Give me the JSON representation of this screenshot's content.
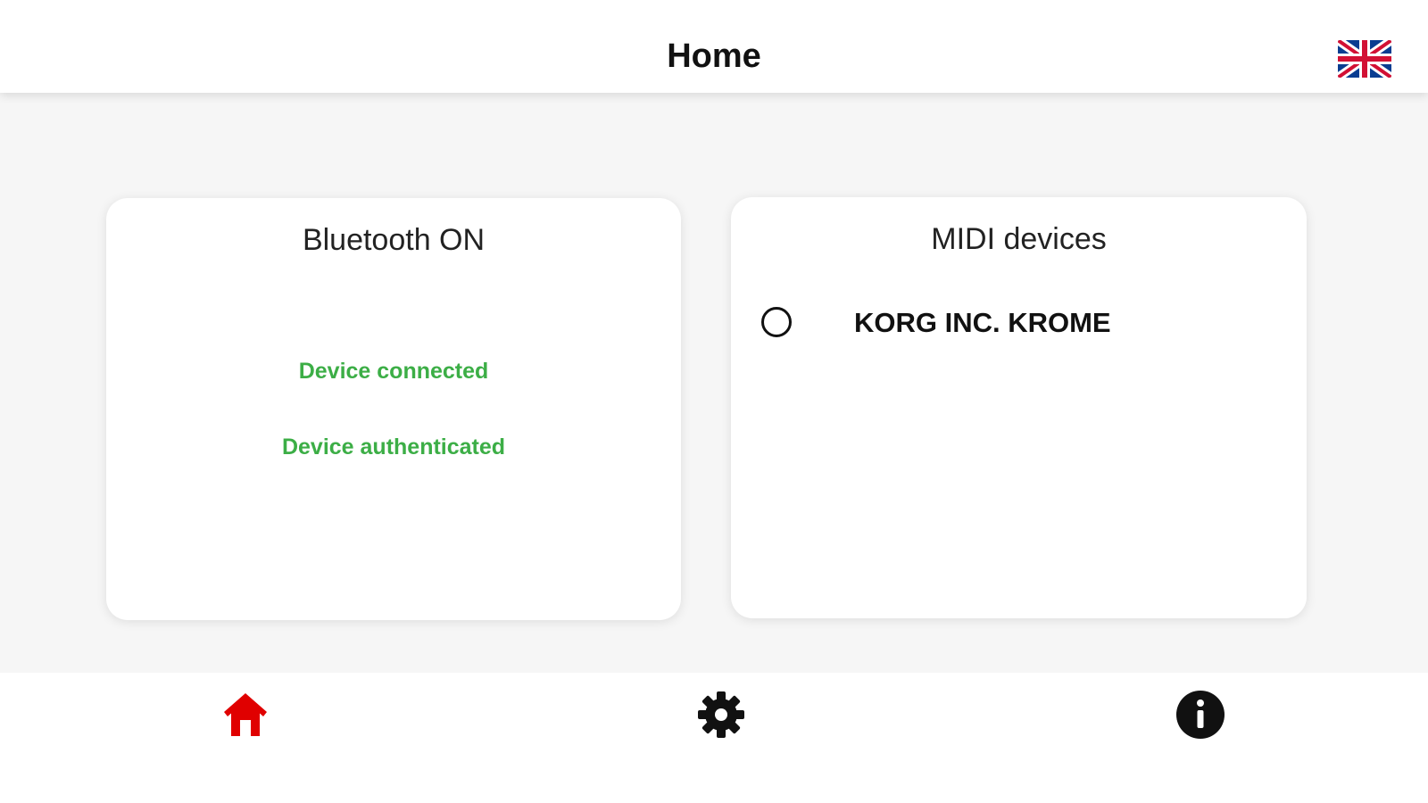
{
  "header": {
    "title": "Home",
    "language_icon": "uk-flag-icon"
  },
  "bluetooth_card": {
    "title": "Bluetooth ON",
    "statuses": [
      "Device connected",
      "Device authenticated"
    ]
  },
  "midi_card": {
    "title": "MIDI devices",
    "devices": [
      {
        "name": "KORG INC. KROME",
        "selected": false
      }
    ]
  },
  "bottom_nav": {
    "items": [
      {
        "icon": "home-icon",
        "active": true,
        "color": "#e00000"
      },
      {
        "icon": "gear-icon",
        "active": false,
        "color": "#111111"
      },
      {
        "icon": "info-icon",
        "active": false,
        "color": "#111111"
      }
    ]
  },
  "colors": {
    "status_green": "#3cae46",
    "active_nav": "#e00000"
  }
}
